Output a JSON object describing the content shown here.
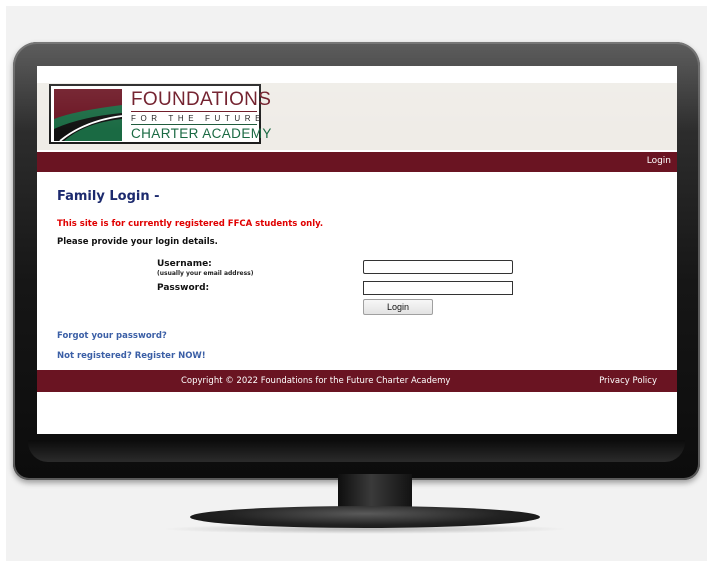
{
  "logo": {
    "line1": "FOUNDATIONS",
    "line2": "FOR THE FUTURE",
    "line3": "CHARTER ACADEMY",
    "colors": {
      "maroon": "#6b1422",
      "green": "#1a6a43"
    }
  },
  "nav": {
    "login_label": "Login"
  },
  "page": {
    "title": "Family Login -",
    "warning": "This site is for currently registered FFCA students only.",
    "instructions": "Please provide your login details."
  },
  "form": {
    "username_label": "Username:",
    "username_hint": "(usually your email address)",
    "username_value": "",
    "password_label": "Password:",
    "password_value": "",
    "submit_label": "Login"
  },
  "links": {
    "forgot_password": "Forgot your password?",
    "register": "Not registered? Register NOW!"
  },
  "footer": {
    "copyright": "Copyright © 2022 Foundations for the Future Charter Academy",
    "privacy": "Privacy Policy"
  },
  "colors": {
    "navbar": "#6a1422",
    "header_bg": "#efece7",
    "title": "#1c2a6e",
    "warning": "#e00000",
    "link": "#3b5fa6"
  }
}
